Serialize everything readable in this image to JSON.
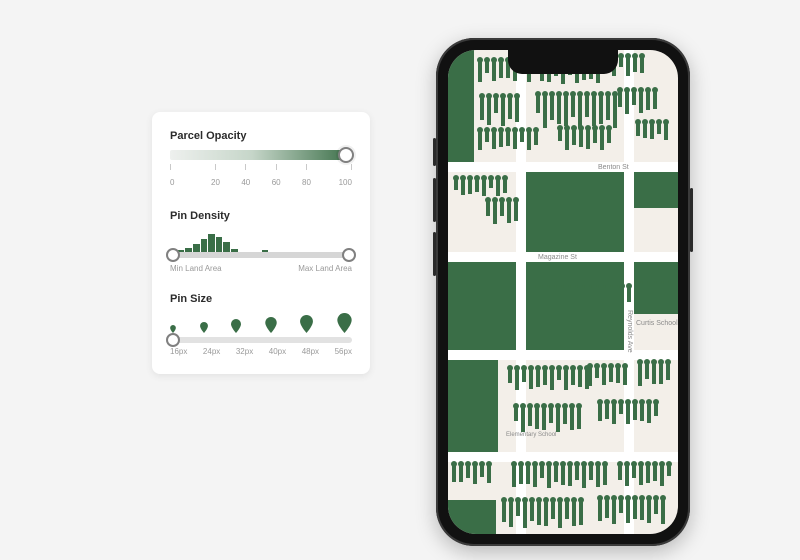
{
  "colors": {
    "accent": "#3a6e47"
  },
  "settings": {
    "opacity": {
      "title": "Parcel Opacity",
      "ticks": [
        "0",
        "20",
        "40",
        "60",
        "80",
        "100"
      ],
      "value": 100
    },
    "density": {
      "title": "Pin Density",
      "min_label": "Min Land Area",
      "max_label": "Max Land Area",
      "histogram": [
        2,
        3,
        5,
        8,
        12,
        16,
        14,
        10,
        4,
        2,
        1,
        0,
        3,
        2,
        0,
        1,
        0,
        0,
        0,
        0,
        0,
        0,
        0,
        0
      ]
    },
    "size": {
      "title": "Pin Size",
      "ticks": [
        "16px",
        "24px",
        "32px",
        "40px",
        "48px",
        "56px"
      ],
      "value": "16px"
    }
  },
  "map": {
    "streets": {
      "benton": "Benton St",
      "magazine": "Magazine St",
      "curtis": "Curtis School",
      "elementary": "Elementary School",
      "reynolds": "Reynolds Ave"
    }
  }
}
